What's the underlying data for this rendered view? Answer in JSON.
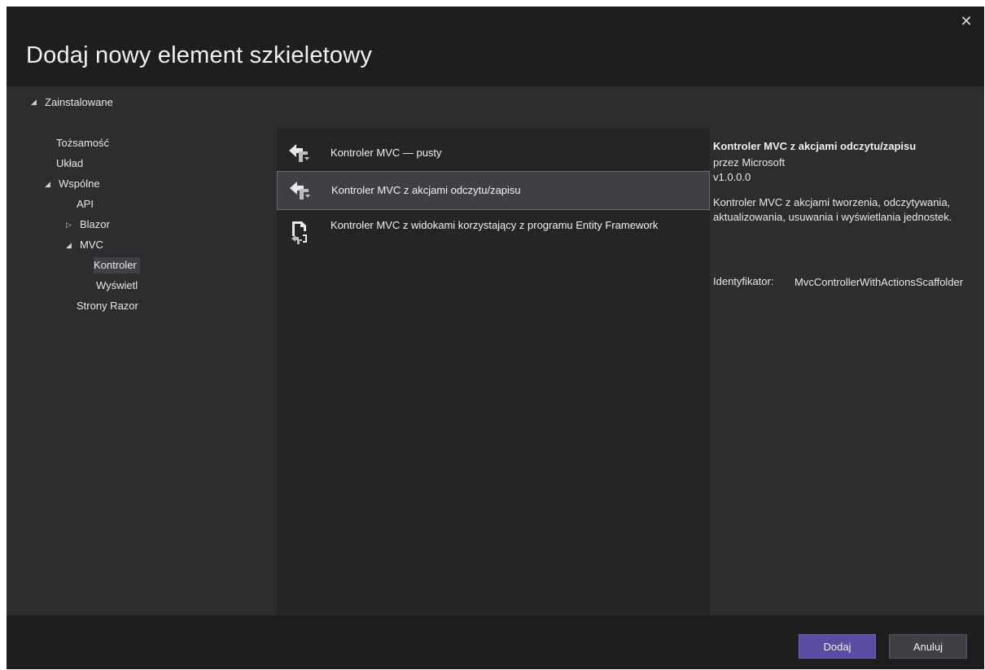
{
  "dialog": {
    "title": "Dodaj nowy element szkieletowy",
    "close_glyph": "✕"
  },
  "tree": {
    "root": "Zainstalowane",
    "items": [
      {
        "label": "Tożsamość"
      },
      {
        "label": "Układ"
      },
      {
        "label": "Wspólne"
      },
      {
        "label": "API"
      },
      {
        "label": "Blazor"
      },
      {
        "label": "MVC"
      },
      {
        "label": "Kontroler"
      },
      {
        "label": "Wyświetl"
      },
      {
        "label": "Strony Razor"
      }
    ]
  },
  "templates": [
    {
      "label": "Kontroler MVC — pusty",
      "icon": "mvc-controller-icon"
    },
    {
      "label": "Kontroler MVC z akcjami odczytu/zapisu",
      "icon": "mvc-controller-icon"
    },
    {
      "label": "Kontroler MVC z widokami korzystający z programu Entity Framework",
      "icon": "entity-framework-controller-icon"
    }
  ],
  "details": {
    "title": "Kontroler MVC z akcjami odczytu/zapisu",
    "author": "przez Microsoft",
    "version": "v1.0.0.0",
    "description": "Kontroler MVC z akcjami tworzenia, odczytywania, aktualizowania, usuwania i wyświetlania jednostek.",
    "id_label": "Identyfikator:",
    "id_value": "MvcControllerWithActionsScaffolder"
  },
  "buttons": {
    "add": "Dodaj",
    "cancel": "Anuluj"
  },
  "colors": {
    "accent": "#5b4ba2",
    "dialog_bg": "#1e1e1e",
    "panel_bg": "#2d2d30",
    "list_bg": "#252526",
    "selection": "#3f3f46"
  }
}
